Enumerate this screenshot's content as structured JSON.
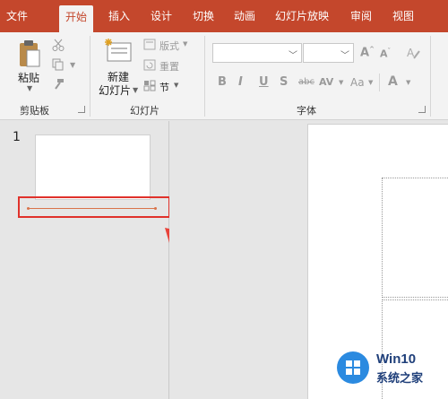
{
  "tabs": [
    {
      "label": "文件",
      "active": false
    },
    {
      "label": "开始",
      "active": true
    },
    {
      "label": "插入",
      "active": false
    },
    {
      "label": "设计",
      "active": false
    },
    {
      "label": "切换",
      "active": false
    },
    {
      "label": "动画",
      "active": false
    },
    {
      "label": "幻灯片放映",
      "active": false
    },
    {
      "label": "审阅",
      "active": false
    },
    {
      "label": "视图",
      "active": false
    }
  ],
  "ribbon": {
    "clipboard": {
      "paste_label": "粘贴",
      "group_label": "剪贴板"
    },
    "slides": {
      "new_slide_line1": "新建",
      "new_slide_line2": "幻灯片",
      "layout_label": "版式",
      "reset_label": "重置",
      "section_label": "节",
      "group_label": "幻灯片"
    },
    "font": {
      "font_name": "",
      "font_size": "",
      "group_label": "字体",
      "buttons": [
        "B",
        "I",
        "U",
        "S",
        "abc",
        "AV",
        "Aa",
        "A"
      ]
    }
  },
  "slides_pane": {
    "slide_number": "1"
  },
  "watermark": {
    "title": "Win10",
    "subtitle": "系统之家"
  },
  "colors": {
    "accent": "#c4472c",
    "highlight_box": "#e0322b",
    "annotation_arrow": "#e8433a"
  }
}
